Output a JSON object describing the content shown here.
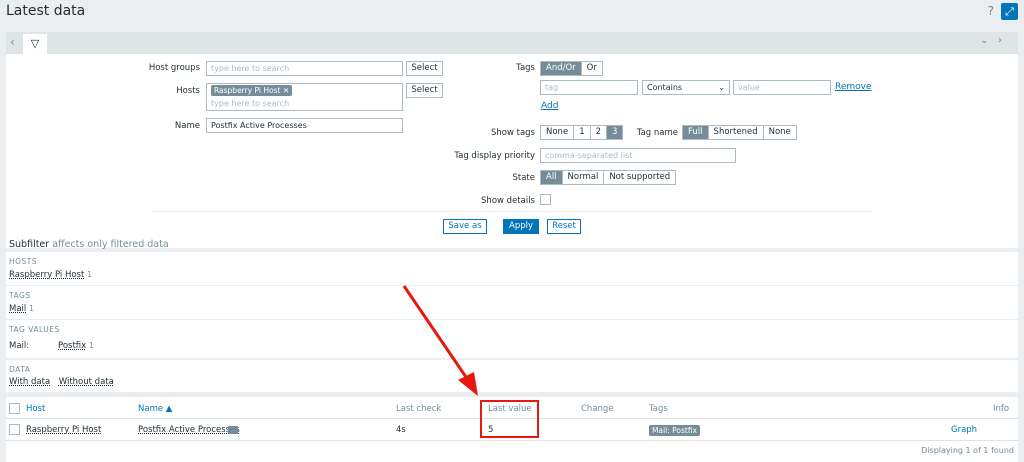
{
  "header": {
    "title": "Latest data",
    "help": "?"
  },
  "filter": {
    "host_groups": {
      "label": "Host groups",
      "placeholder": "type here to search",
      "select": "Select"
    },
    "hosts": {
      "label": "Hosts",
      "chip": "Raspberry Pi Host",
      "placeholder": "type here to search",
      "select": "Select"
    },
    "name": {
      "label": "Name",
      "value": "Postfix Active Processes"
    },
    "tags": {
      "label": "Tags",
      "and_or": "And/Or",
      "or": "Or",
      "tag_placeholder": "tag",
      "operator": "Contains",
      "value_placeholder": "value",
      "remove": "Remove",
      "add": "Add"
    },
    "show_tags": {
      "label": "Show tags",
      "options": [
        "None",
        "1",
        "2",
        "3"
      ],
      "selected": "3"
    },
    "tag_name": {
      "label": "Tag name",
      "options": [
        "Full",
        "Shortened",
        "None"
      ],
      "selected": "Full"
    },
    "tag_priority": {
      "label": "Tag display priority",
      "placeholder": "comma-separated list"
    },
    "state": {
      "label": "State",
      "options": [
        "All",
        "Normal",
        "Not supported"
      ],
      "selected": "All"
    },
    "show_details": {
      "label": "Show details"
    },
    "buttons": {
      "save_as": "Save as",
      "apply": "Apply",
      "reset": "Reset"
    }
  },
  "subfilter": {
    "title": "Subfilter",
    "note": "affects only filtered data",
    "hosts": {
      "heading": "HOSTS",
      "item": "Raspberry Pi Host",
      "count": "1"
    },
    "tags": {
      "heading": "TAGS",
      "item": "Mail",
      "count": "1"
    },
    "tag_values": {
      "heading": "TAG VALUES",
      "key": "Mail:",
      "item": "Postfix",
      "count": "1"
    },
    "data": {
      "heading": "DATA",
      "with": "With data",
      "without": "Without data"
    }
  },
  "table": {
    "headers": {
      "host": "Host",
      "name": "Name ▲",
      "last_check": "Last check",
      "last_value": "Last value",
      "change": "Change",
      "tags": "Tags",
      "info": "Info"
    },
    "row": {
      "host": "Raspberry Pi Host",
      "name": "Postfix Active Processes",
      "last_check": "4s",
      "last_value": "5",
      "change": "",
      "tag": "Mail: Postfix",
      "graph": "Graph"
    },
    "footer": "Displaying 1 of 1 found"
  },
  "colors": {
    "accent": "#0275b8",
    "annotation": "#e8170f"
  }
}
